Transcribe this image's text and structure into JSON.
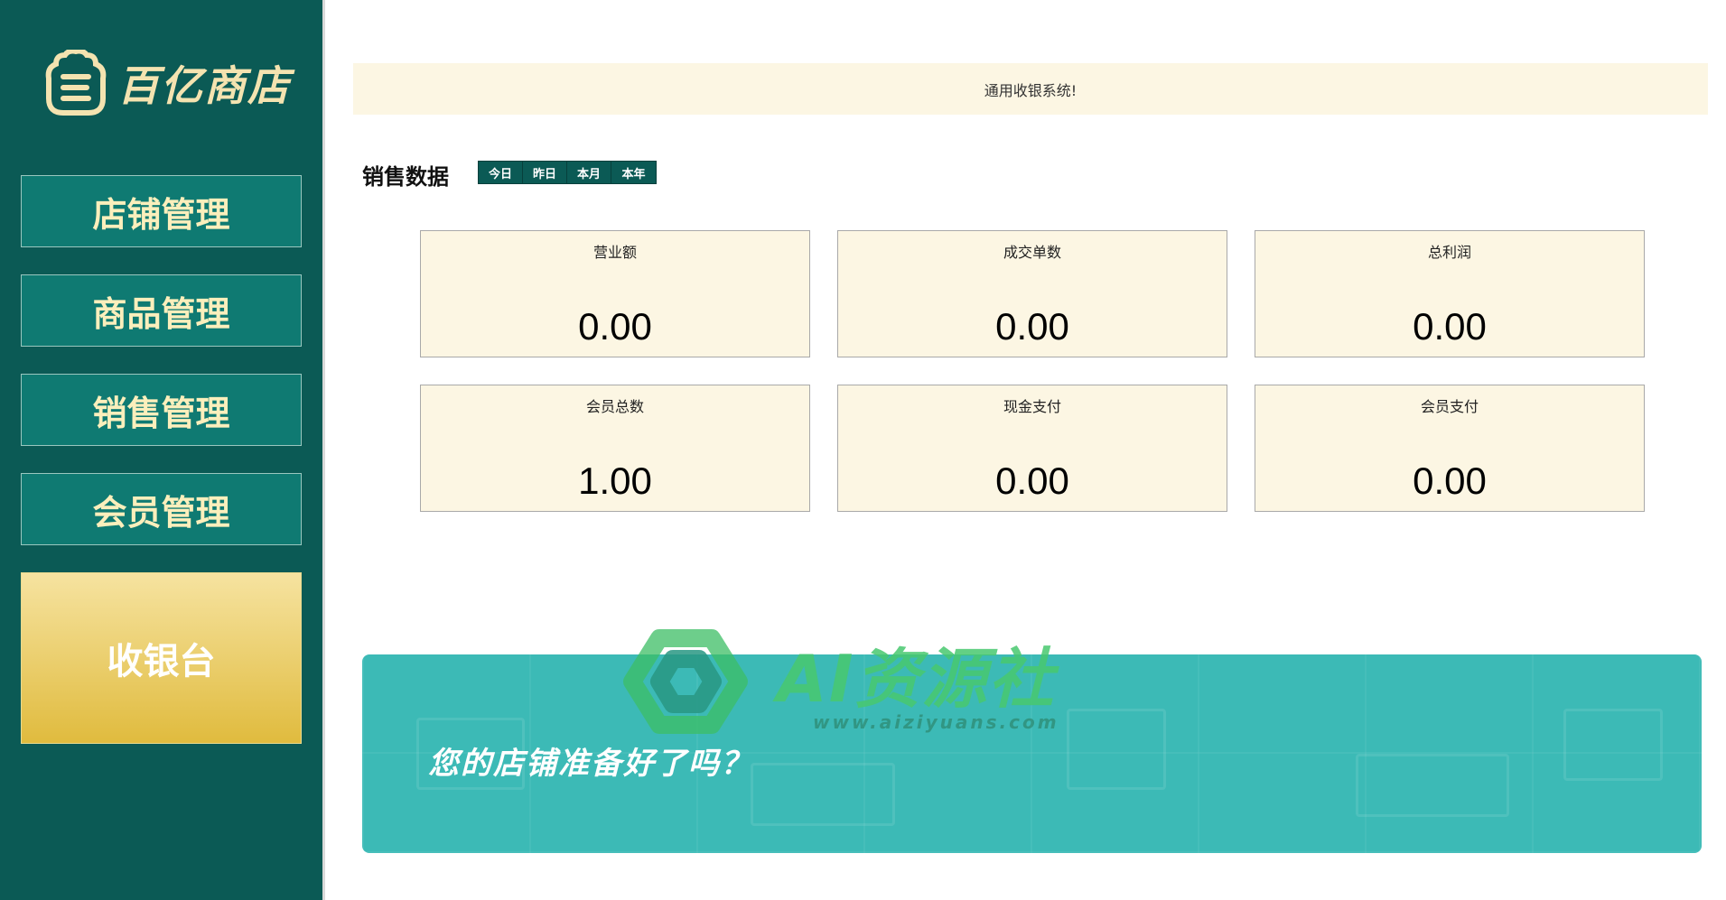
{
  "brand": {
    "logo_text": "百亿商店",
    "colors": {
      "sidebar": "#0b5a55",
      "nav": "#0f7a72",
      "nav_text": "#fbefbc",
      "cashier_gradient_top": "#f6e3a0",
      "cashier_gradient_bottom": "#e0bb3e",
      "card_bg": "#fcf6e3",
      "banner": "#3cbab6"
    }
  },
  "sidebar": {
    "items": [
      {
        "label": "店铺管理"
      },
      {
        "label": "商品管理"
      },
      {
        "label": "销售管理"
      },
      {
        "label": "会员管理"
      }
    ],
    "cashier": {
      "label": "收银台"
    }
  },
  "notice": {
    "text": "通用收银系统!"
  },
  "sales": {
    "title": "销售数据",
    "periods": [
      "今日",
      "昨日",
      "本月",
      "本年"
    ],
    "stats": [
      {
        "label": "营业额",
        "value": "0.00"
      },
      {
        "label": "成交单数",
        "value": "0.00"
      },
      {
        "label": "总利润",
        "value": "0.00"
      },
      {
        "label": "会员总数",
        "value": "1.00"
      },
      {
        "label": "现金支付",
        "value": "0.00"
      },
      {
        "label": "会员支付",
        "value": "0.00"
      }
    ]
  },
  "banner": {
    "text": "您的店铺准备好了吗？"
  },
  "watermark": {
    "text": "AI资源社",
    "url": "www.aiziyuans.com",
    "icon": "knot-logo-icon"
  }
}
